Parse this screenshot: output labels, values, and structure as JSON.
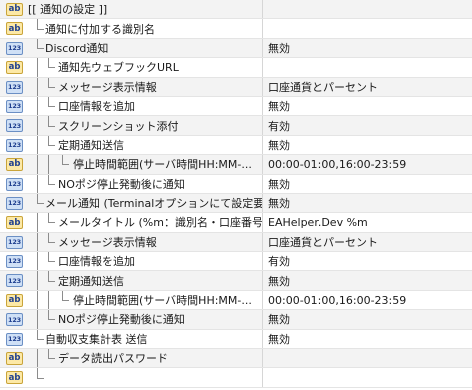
{
  "rows": [
    {
      "label": "[[ 通知の設定 ]]",
      "value": "",
      "icon": "ab",
      "depth": 0
    },
    {
      "label": "通知に付加する識別名",
      "value": "",
      "icon": "ab",
      "depth": 1
    },
    {
      "label": "Discord通知",
      "value": "無効",
      "icon": "num",
      "depth": 1
    },
    {
      "label": "通知先ウェブフックURL",
      "value": "",
      "icon": "ab",
      "depth": 2
    },
    {
      "label": "メッセージ表示情報",
      "value": "口座通貨とパーセント",
      "icon": "num",
      "depth": 2
    },
    {
      "label": "口座情報を追加",
      "value": "無効",
      "icon": "num",
      "depth": 2
    },
    {
      "label": "スクリーンショット添付",
      "value": "有効",
      "icon": "num",
      "depth": 2
    },
    {
      "label": "定期通知送信",
      "value": "無効",
      "icon": "num",
      "depth": 2
    },
    {
      "label": "停止時間範囲(サーバ時間HH:MM-...",
      "value": "00:00-01:00,16:00-23:59",
      "icon": "ab",
      "depth": 3
    },
    {
      "label": "NOポジ停止発動後に通知",
      "value": "無効",
      "icon": "num",
      "depth": 2
    },
    {
      "label": "メール通知 (Terminalオプションにて設定要)",
      "value": "無効",
      "icon": "num",
      "depth": 1
    },
    {
      "label": "メールタイトル (%m：識別名・口座番号...",
      "value": "EAHelper.Dev %m",
      "icon": "ab",
      "depth": 2
    },
    {
      "label": "メッセージ表示情報",
      "value": "口座通貨とパーセント",
      "icon": "num",
      "depth": 2
    },
    {
      "label": "口座情報を追加",
      "value": "有効",
      "icon": "num",
      "depth": 2
    },
    {
      "label": "定期通知送信",
      "value": "無効",
      "icon": "num",
      "depth": 2
    },
    {
      "label": "停止時間範囲(サーバ時間HH:MM-...",
      "value": "00:00-01:00,16:00-23:59",
      "icon": "ab",
      "depth": 3
    },
    {
      "label": "NOポジ停止発動後に通知",
      "value": "無効",
      "icon": "num",
      "depth": 2
    },
    {
      "label": "自動収支集計表 送信",
      "value": "無効",
      "icon": "num",
      "depth": 1
    },
    {
      "label": "データ読出パスワード",
      "value": "",
      "icon": "ab",
      "depth": 2
    },
    {
      "label": "",
      "value": "",
      "icon": "ab",
      "depth": 1
    }
  ],
  "icon_text": {
    "ab": "ab",
    "num": "123"
  }
}
